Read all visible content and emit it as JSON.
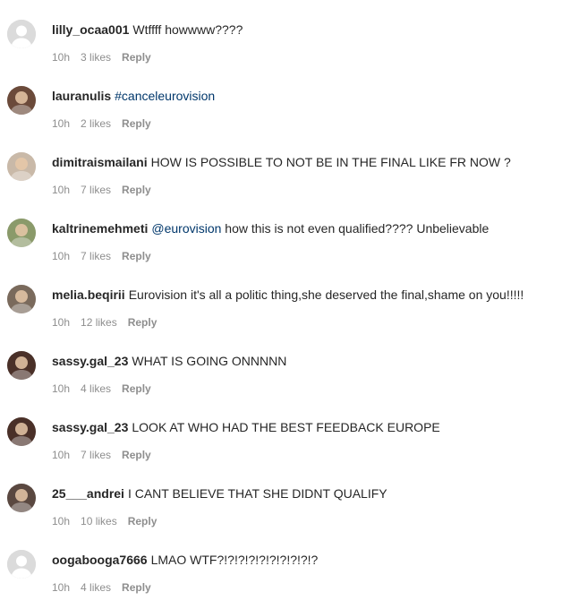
{
  "comments": [
    {
      "username": "lilly_ocaa001",
      "mention": "",
      "text": "Wtffff howwww????",
      "time": "10h",
      "likes": "3 likes",
      "reply": "Reply",
      "avatar": "default-avatar-icon",
      "color": "#dbdbdb"
    },
    {
      "username": "lauranulis",
      "mention": "#canceleurovision",
      "text": "",
      "time": "10h",
      "likes": "2 likes",
      "reply": "Reply",
      "avatar": "profile-photo",
      "color": "#6b4a3a"
    },
    {
      "username": "dimitraismailani",
      "mention": "",
      "text": "HOW IS POSSIBLE TO NOT BE IN THE FINAL LIKE FR NOW ?",
      "time": "10h",
      "likes": "7 likes",
      "reply": "Reply",
      "avatar": "profile-photo",
      "color": "#c9b9a8"
    },
    {
      "username": "kaltrinemehmeti",
      "mention": "@eurovision",
      "text": "how this is not even qualified???? Unbelievable",
      "time": "10h",
      "likes": "7 likes",
      "reply": "Reply",
      "avatar": "profile-photo",
      "color": "#8a9a6a"
    },
    {
      "username": "melia.beqirii",
      "mention": "",
      "text": "Eurovision it's all a politic thing,she deserved the final,shame on you!!!!!",
      "time": "10h",
      "likes": "12 likes",
      "reply": "Reply",
      "avatar": "profile-photo",
      "color": "#7a6a5c"
    },
    {
      "username": "sassy.gal_23",
      "mention": "",
      "text": "WHAT IS GOING ONNNNN",
      "time": "10h",
      "likes": "4 likes",
      "reply": "Reply",
      "avatar": "profile-photo",
      "color": "#4a3028"
    },
    {
      "username": "sassy.gal_23",
      "mention": "",
      "text": "LOOK AT WHO HAD THE BEST FEEDBACK EUROPE",
      "time": "10h",
      "likes": "7 likes",
      "reply": "Reply",
      "avatar": "profile-photo",
      "color": "#4a3028"
    },
    {
      "username": "25___andrei",
      "mention": "",
      "text": "I CANT BELIEVE THAT SHE DIDNT QUALIFY",
      "time": "10h",
      "likes": "10 likes",
      "reply": "Reply",
      "avatar": "profile-photo",
      "color": "#5a4840"
    },
    {
      "username": "oogabooga7666",
      "mention": "",
      "text": "LMAO WTF?!?!?!?!?!?!?!?!?!?",
      "time": "10h",
      "likes": "4 likes",
      "reply": "Reply",
      "avatar": "default-avatar-icon",
      "color": "#dbdbdb"
    }
  ]
}
